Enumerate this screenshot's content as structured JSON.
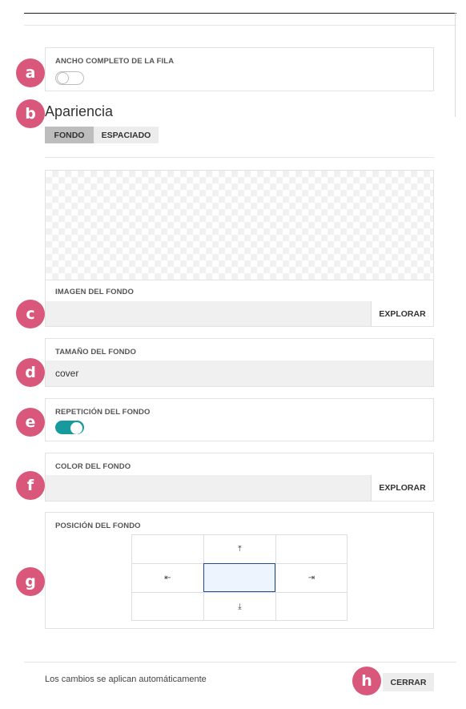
{
  "row_full_width": {
    "label": "ANCHO COMPLETO DE LA FILA",
    "enabled": false
  },
  "appearance": {
    "title": "Apariencia",
    "tabs": [
      {
        "label": "FONDO",
        "active": true
      },
      {
        "label": "ESPACIADO",
        "active": false
      }
    ]
  },
  "background_image": {
    "label": "IMAGEN DEL FONDO",
    "value": "",
    "browse_label": "EXPLORAR"
  },
  "background_size": {
    "label": "TAMAÑO DEL FONDO",
    "value": "cover"
  },
  "background_repeat": {
    "label": "REPETICIÓN DEL FONDO",
    "enabled": true
  },
  "background_color": {
    "label": "COLOR DEL FONDO",
    "value": "",
    "browse_label": "EXPLORAR"
  },
  "background_position": {
    "label": "POSICIÓN DEL FONDO",
    "cells": [
      "",
      "⤒",
      "",
      "⇤",
      "",
      "⇥",
      "",
      "⤓",
      ""
    ],
    "selected": "center"
  },
  "footer": {
    "note": "Los cambios se aplican automáticamente",
    "close_label": "CERRAR"
  },
  "badges": [
    "a",
    "b",
    "c",
    "d",
    "e",
    "f",
    "g",
    "h"
  ],
  "colors": {
    "badge": "#d9577b",
    "toggle_on": "#179a9d",
    "selected_border": "#1f4e8c"
  }
}
